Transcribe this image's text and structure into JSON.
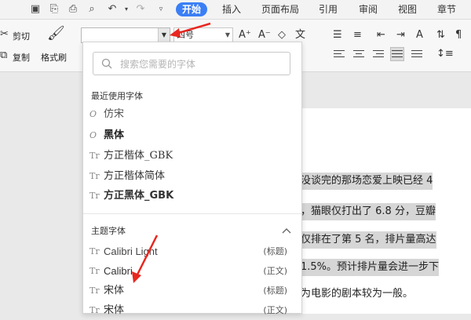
{
  "tabs": [
    {
      "label": "开始",
      "active": true
    },
    {
      "label": "插入",
      "active": false
    },
    {
      "label": "页面布局",
      "active": false
    },
    {
      "label": "引用",
      "active": false
    },
    {
      "label": "审阅",
      "active": false
    },
    {
      "label": "视图",
      "active": false
    },
    {
      "label": "章节",
      "active": false
    }
  ],
  "ribbon": {
    "cut_label": "剪切",
    "copy_label": "复制",
    "format_painter_label": "格式刷",
    "font_name_value": "",
    "font_size_value": "四号"
  },
  "font_panel": {
    "search_placeholder": "搜索您需要的字体",
    "recent_title": "最近使用字体",
    "theme_title": "主题字体",
    "recent_fonts": [
      {
        "name": "仿宋",
        "icon": "O"
      },
      {
        "name": "黑体",
        "icon": "O"
      },
      {
        "name": "方正楷体_GBK",
        "icon": "Tr"
      },
      {
        "name": "方正楷体简体",
        "icon": "Tr"
      },
      {
        "name": "方正黑体_GBK",
        "icon": "Tr"
      }
    ],
    "theme_fonts": [
      {
        "name": "Calibri Light",
        "tag": "(标题)",
        "icon": "Tr"
      },
      {
        "name": "Calibri",
        "tag": "(正文)",
        "icon": "Tr"
      },
      {
        "name": "宋体",
        "tag": "(标题)",
        "icon": "Tr"
      },
      {
        "name": "宋体",
        "tag": "(正文)",
        "icon": "Tr"
      }
    ]
  },
  "document": {
    "lines": [
      "没谈完的那场恋爱上映已经 4",
      "，猫眼仅打出了 6.8 分，豆瓣",
      "仅排在了第 5 名，排片量高达",
      " 1.5%。预计排片量会进一步下",
      "为电影的剧本较为一般。"
    ]
  },
  "colors": {
    "accent": "#3b7ff5",
    "annotation_arrow": "#e8271f"
  }
}
